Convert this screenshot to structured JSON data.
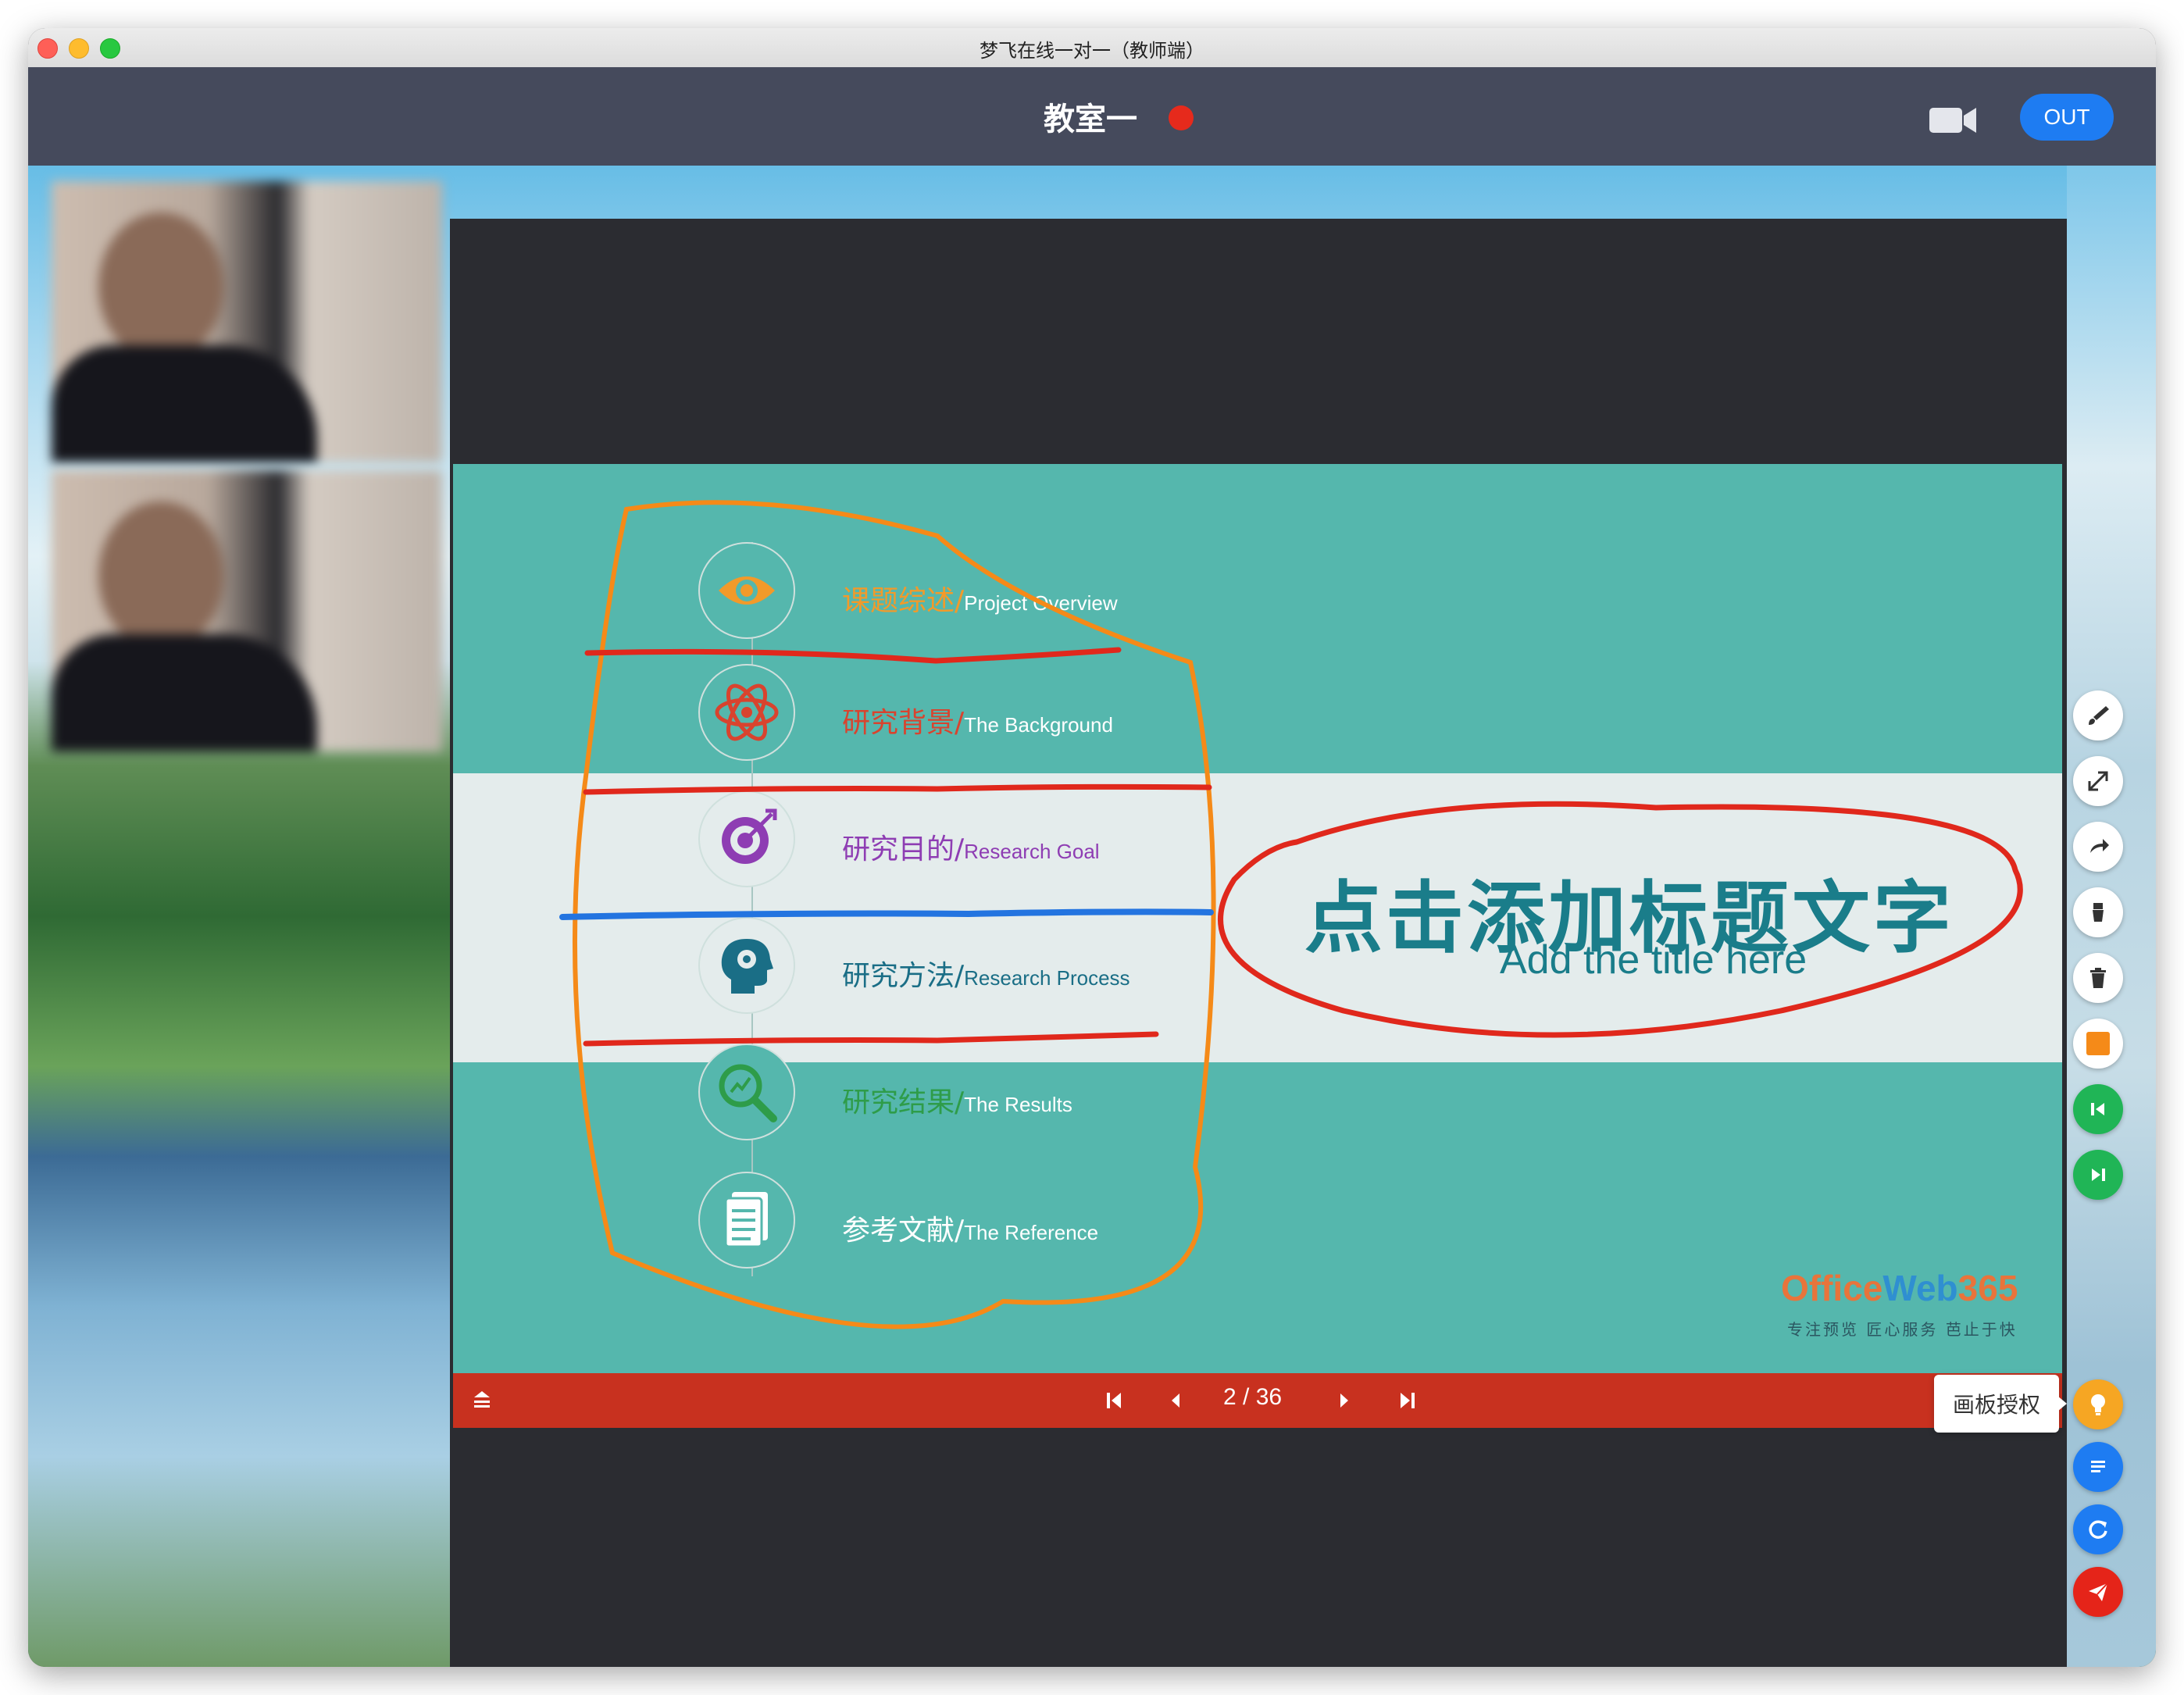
{
  "window": {
    "title": "梦飞在线一对一（教师端）"
  },
  "header": {
    "room_title": "教室一",
    "out_label": "OUT",
    "recording_color": "#e62a1c",
    "camera_icon": "video-camera-icon"
  },
  "slide": {
    "agenda": [
      {
        "zh": "课题综述/",
        "en": "Project Overview",
        "color": "#f29a2a",
        "icon": "eye-icon"
      },
      {
        "zh": "研究背景/",
        "en": "The Background",
        "color": "#d9432e",
        "icon": "atom-icon"
      },
      {
        "zh": "研究目的/",
        "en": "Research Goal",
        "color": "#8e3db3",
        "icon": "target-icon"
      },
      {
        "zh": "研究方法/",
        "en": "Research Process",
        "color": "#1a6e86",
        "icon": "head-icon"
      },
      {
        "zh": "研究结果/",
        "en": "The Results",
        "color": "#2e9c49",
        "icon": "magnifier-chart-icon"
      },
      {
        "zh": "参考文献/",
        "en": "The Reference",
        "color": "#ffffff",
        "icon": "document-icon"
      }
    ],
    "title_zh": "点击添加标题文字",
    "title_en": "Add the title here",
    "brand": {
      "part1": "Office",
      "part2": "Web",
      "part3": "365",
      "tagline": "专注预览  匠心服务  芭止于快"
    }
  },
  "nav": {
    "page": "2 / 36",
    "first_icon": "first-page-icon",
    "prev_icon": "previous-page-icon",
    "next_icon": "next-page-icon",
    "last_icon": "last-page-icon"
  },
  "toolbar": {
    "tooltip": "画板授权",
    "tools": [
      "brush-icon",
      "expand-icon",
      "redo-icon",
      "eraser-icon",
      "trash-icon",
      "color-square-icon",
      "prev-slide-icon",
      "next-slide-icon",
      "light-bulb-icon",
      "list-icon",
      "refresh-icon",
      "send-icon"
    ]
  }
}
